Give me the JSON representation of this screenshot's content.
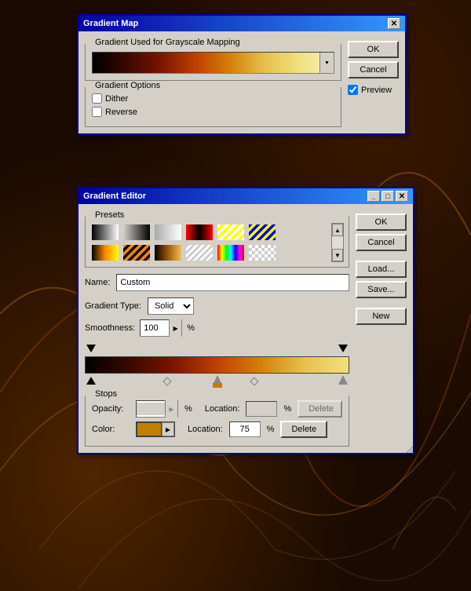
{
  "gradient_map_dialog": {
    "title": "Gradient Map",
    "gradient_section_label": "Gradient Used for Grayscale Mapping",
    "gradient_options_label": "Gradient Options",
    "dither_label": "Dither",
    "reverse_label": "Reverse",
    "ok_label": "OK",
    "cancel_label": "Cancel",
    "preview_label": "Preview",
    "dither_checked": false,
    "reverse_checked": false,
    "preview_checked": true
  },
  "gradient_editor_dialog": {
    "title": "Gradient Editor",
    "presets_label": "Presets",
    "ok_label": "OK",
    "cancel_label": "Cancel",
    "load_label": "Load...",
    "save_label": "Save...",
    "name_label": "Name:",
    "name_value": "Custom",
    "new_label": "New",
    "gradient_type_label": "Gradient Type:",
    "gradient_type_value": "Solid",
    "smoothness_label": "Smoothness:",
    "smoothness_value": "100",
    "percent_sign": "%",
    "stops_label": "Stops",
    "opacity_label": "Opacity:",
    "opacity_location_label": "Location:",
    "opacity_percent": "%",
    "opacity_delete_label": "Delete",
    "color_label": "Color:",
    "color_location_label": "Location:",
    "color_location_value": "75",
    "color_percent": "%",
    "color_delete_label": "Delete"
  }
}
